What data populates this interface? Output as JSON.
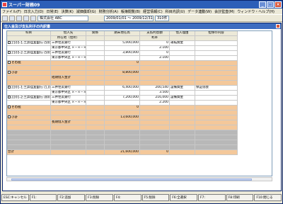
{
  "app": {
    "title": "スーパー財務09"
  },
  "menu": [
    "ファイル(F)",
    "日次入力(D)",
    "日常(E)",
    "決算(K)",
    "減価償却(G)",
    "財務分析(A)",
    "帳簿閲覧(B)",
    "経営情報(C)",
    "科目内訳(U)",
    "データ連動(W)",
    "会計監査(M)",
    "ウィンドウ・ヘルプ(H)"
  ],
  "toolbar": {
    "company": "株式会社 ABC",
    "period": "2009/01/01 ～ 2009/12/31",
    "days": "310件"
  },
  "window": {
    "title": "仕入金及び支払利子の内訳書"
  },
  "actions": [
    {
      "label": "科目選択",
      "icon": "folder-icon",
      "color": "#e8b020"
    },
    {
      "label": "残高取込",
      "icon": "import-icon",
      "color": "#2e9a3a"
    },
    {
      "label": "並び替え",
      "icon": "sort-icon",
      "color": "#2e9a3a"
    },
    {
      "label": "上へ",
      "icon": "up-arrow-icon",
      "color": "#b0b0b0"
    },
    {
      "label": "下へ",
      "icon": "down-arrow-icon",
      "color": "#d42020"
    }
  ],
  "table": {
    "headers": {
      "h1": [
        "科目",
        "借入先",
        "関係",
        "期末現在高",
        "支払利息額",
        "借入理由",
        "担保の内容"
      ],
      "h2": [
        "所在地（住所）",
        "利率"
      ]
    },
    "rows": [
      {
        "kind": "entry",
        "subject": "2103-1:三井住友銀行 (500万)",
        "lender": "三井住友銀行",
        "balance": "5,000,000",
        "interest": "0",
        "reason": "運転資金",
        "addr": "東京都中央区 ×－×－×",
        "rate": "2.100"
      },
      {
        "kind": "entry",
        "subject": "2103-2:三井住友銀行 (500万)",
        "lender": "三井住友銀行",
        "balance": "3,800,000",
        "interest": "0",
        "reason": "",
        "addr": "東京都中央区 ×－×－×",
        "rate": "2.100"
      },
      {
        "kind": "other",
        "subject": "その他",
        "balance": "0"
      },
      {
        "kind": "subtotal",
        "subject": "小計",
        "balance": "8,800,000"
      },
      {
        "kind": "label",
        "subject": "",
        "lender": "短期借入金計"
      },
      {
        "kind": "entry",
        "subject": "2201-1:三井住友銀行 (1,000万)",
        "lender": "三井住友銀行",
        "balance": "6,400,000",
        "interest": "200,540",
        "reason": "設備資金",
        "collateral": "保証協会",
        "addr": "東京都中央区 ×－×－×",
        "rate": "3.500"
      },
      {
        "kind": "entry",
        "subject": "2201-2:三井住友銀行 (800万)",
        "lender": "三井住友銀行",
        "balance": "7,200,000",
        "interest": "216,000",
        "reason": "設備資金",
        "addr": "東京都中央区 ×－×－×",
        "rate": "2.200"
      },
      {
        "kind": "other",
        "subject": "その他",
        "balance": "0"
      },
      {
        "kind": "subtotal",
        "subject": "小計",
        "balance": "13,600,000"
      },
      {
        "kind": "label",
        "subject": "",
        "lender": "長期借入金計"
      },
      {
        "kind": "total",
        "subject": "合計",
        "balance": "21,600,000",
        "interest": "0"
      }
    ]
  },
  "fkeys": [
    "ESC:キャンセル",
    "F1:",
    "F2:追加",
    "F3:削除",
    "F4:",
    "F5:削除",
    "F6:全選択",
    "F7:",
    "F8:印刷",
    "F10:閉じる"
  ]
}
